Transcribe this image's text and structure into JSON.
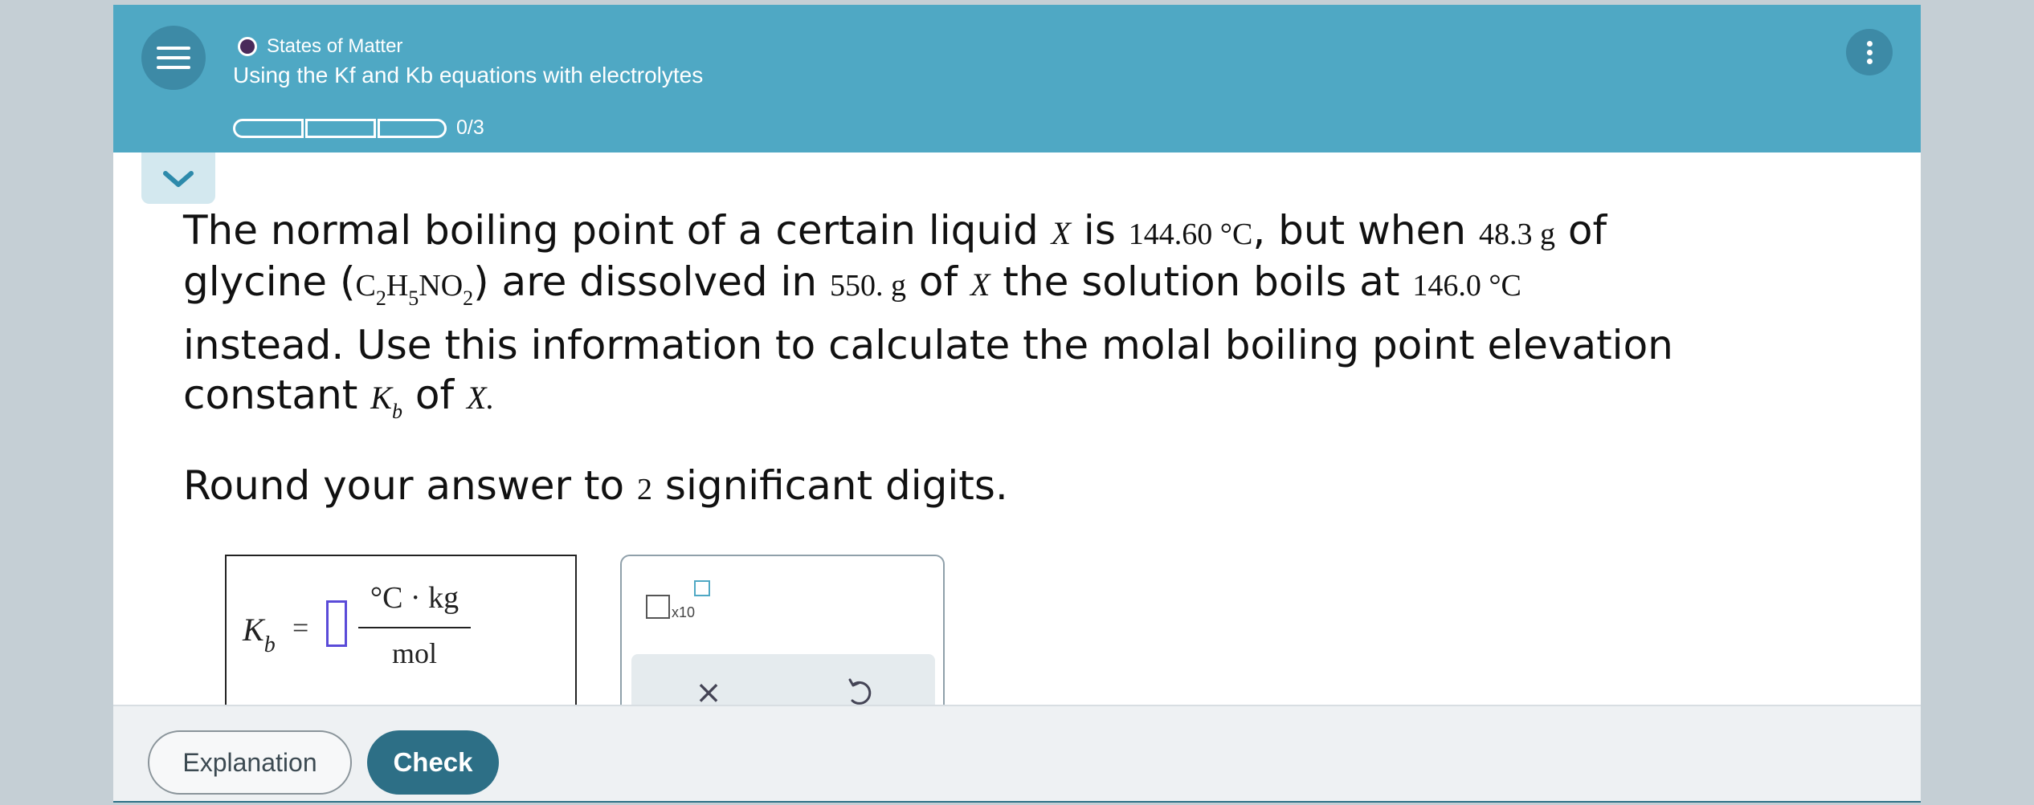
{
  "header": {
    "topic": "States of Matter",
    "lesson_title": "Using the Kf and Kb equations with electrolytes",
    "progress": {
      "label": "0/3",
      "completed": 0,
      "total": 3
    }
  },
  "question": {
    "line1": {
      "t1": "The normal boiling point of a certain liquid ",
      "var_x": "X",
      "t2": " is ",
      "bp_value": "144.60",
      "bp_unit": "°C",
      "t3": ", but when ",
      "mass_solute": "48.3",
      "mass_unit": "g",
      "t4": " of"
    },
    "line2": {
      "t1": "glycine (",
      "f_c": "C",
      "f_c_sub": "2",
      "f_h": "H",
      "f_h_sub": "5",
      "f_no": "NO",
      "f_o_sub": "2",
      "t2": ") are dissolved in ",
      "mass_solvent": "550.",
      "mass_unit": "g",
      "t3": " of ",
      "var_x": "X",
      "t4": " the solution boils at ",
      "new_bp": "146.0",
      "new_bp_unit": "°C"
    },
    "line3": "instead. Use this information to calculate the molal boiling point elevation",
    "line4": {
      "t1": "constant ",
      "k": "K",
      "k_sub": "b",
      "t2": " of ",
      "var_x": "X."
    },
    "round": {
      "t1": "Round your answer to ",
      "digits": "2",
      "t2": " significant digits."
    }
  },
  "answer": {
    "label": "K",
    "label_sub": "b",
    "equals": "=",
    "value": "",
    "unit_numerator": "°C · kg",
    "unit_denominator": "mol"
  },
  "palette": {
    "sci_label": "x10",
    "clear_symbol": "×"
  },
  "footer": {
    "explanation_label": "Explanation",
    "check_label": "Check"
  },
  "colors": {
    "header_bg": "#4fa8c4",
    "check_bg": "#2d6f86",
    "input_border": "#5a4bd8"
  }
}
